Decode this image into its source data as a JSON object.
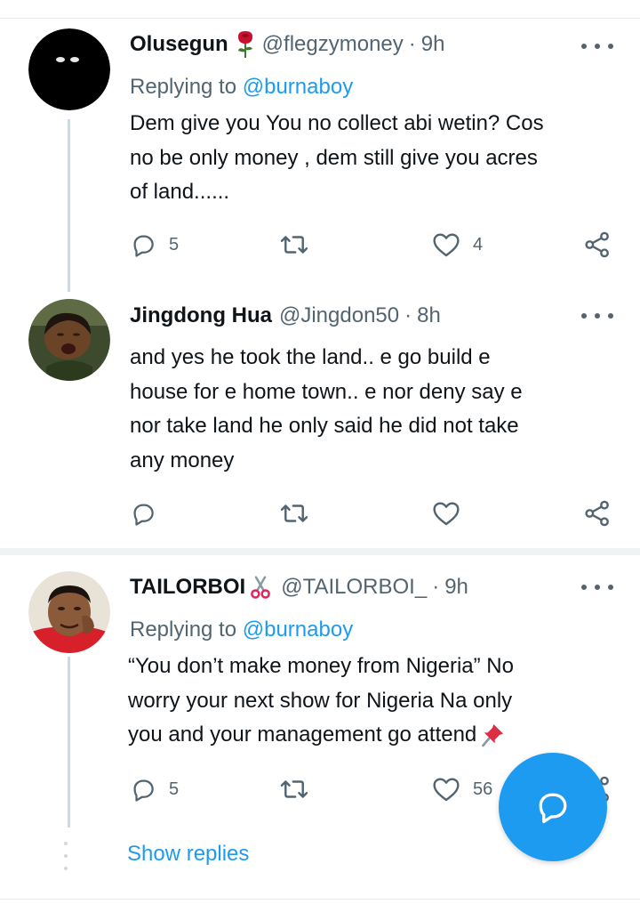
{
  "colors": {
    "accent": "#1d9bf0",
    "muted": "#536471",
    "text": "#0f1419",
    "divider": "#eff3f4"
  },
  "tweets": [
    {
      "name": "Olusegun",
      "name_emoji": "rose-icon",
      "handle": "@flegzymoney",
      "separator": "·",
      "time": "9h",
      "replying_prefix": "Replying to",
      "replying_handle": "@burnaboy",
      "lines": [
        "Dem give you You no collect abi wetin? Cos",
        "no be only money , dem still give you acres",
        "of land......"
      ],
      "replies": "5",
      "likes": "4"
    },
    {
      "name": "Jingdong Hua",
      "handle": "@Jingdon50",
      "separator": "·",
      "time": "8h",
      "lines": [
        "and yes he took the land.. e go build e",
        "house for e home town.. e nor deny say e",
        "nor take land he only said he did not take",
        "any money"
      ]
    },
    {
      "name": "TAILORBOI",
      "name_emoji": "scissors-icon",
      "handle": "@TAILORBOI_",
      "separator": "·",
      "time": "9h",
      "replying_prefix": "Replying to",
      "replying_handle": "@burnaboy",
      "lines": [
        "“You don’t make money from Nigeria” No",
        "worry your next show for Nigeria Na only",
        "you and your management go attend"
      ],
      "replies": "5",
      "likes": "56"
    }
  ],
  "show_replies": "Show replies"
}
